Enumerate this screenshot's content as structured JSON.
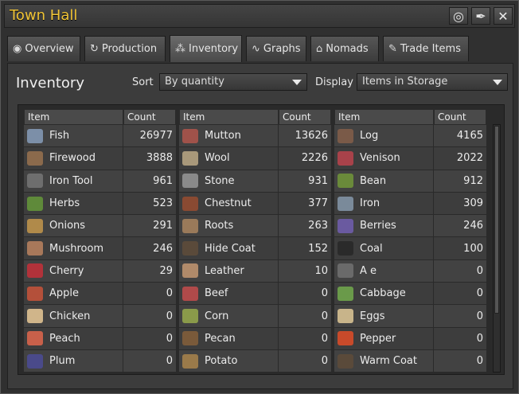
{
  "window": {
    "title": "Town Hall"
  },
  "window_buttons": [
    {
      "name": "target-icon",
      "glyph": "◎"
    },
    {
      "name": "pin-icon",
      "glyph": "✒"
    },
    {
      "name": "close-icon",
      "glyph": "✕"
    }
  ],
  "tabs": [
    {
      "label": "Overview",
      "icon": "eye-icon",
      "glyph": "◉",
      "active": false
    },
    {
      "label": "Production",
      "icon": "cycle-icon",
      "glyph": "↻",
      "active": false
    },
    {
      "label": "Inventory",
      "icon": "inventory-icon",
      "glyph": "⁂",
      "active": true
    },
    {
      "label": "Graphs",
      "icon": "graph-icon",
      "glyph": "∿",
      "active": false
    },
    {
      "label": "Nomads",
      "icon": "house-icon",
      "glyph": "⌂",
      "active": false
    },
    {
      "label": "Trade Items",
      "icon": "tag-icon",
      "glyph": "✎",
      "active": false
    }
  ],
  "inventory": {
    "title": "Inventory",
    "sort_label": "Sort",
    "sort_value": "By quantity",
    "display_label": "Display",
    "display_value": "Items in Storage"
  },
  "table": {
    "header_item": "Item",
    "header_count": "Count",
    "columns": [
      [
        {
          "name": "Fish",
          "count": "26977",
          "icon": "fish-icon",
          "color": "#7c8fa8"
        },
        {
          "name": "Firewood",
          "count": "3888",
          "icon": "firewood-icon",
          "color": "#8b6a4c"
        },
        {
          "name": "Iron Tool",
          "count": "961",
          "icon": "iron-tool-icon",
          "color": "#6e6e6e"
        },
        {
          "name": "Herbs",
          "count": "523",
          "icon": "herbs-icon",
          "color": "#5f8a3a"
        },
        {
          "name": "Onions",
          "count": "291",
          "icon": "onions-icon",
          "color": "#b08a4a"
        },
        {
          "name": "Mushroom",
          "count": "246",
          "icon": "mushroom-icon",
          "color": "#a8785a"
        },
        {
          "name": "Cherry",
          "count": "29",
          "icon": "cherry-icon",
          "color": "#b2323a"
        },
        {
          "name": "Apple",
          "count": "0",
          "icon": "apple-icon",
          "color": "#b4503a"
        },
        {
          "name": "Chicken",
          "count": "0",
          "icon": "chicken-icon",
          "color": "#d0b58a"
        },
        {
          "name": "Peach",
          "count": "0",
          "icon": "peach-icon",
          "color": "#c8604a"
        },
        {
          "name": "Plum",
          "count": "0",
          "icon": "plum-icon",
          "color": "#4a4a8a"
        }
      ],
      [
        {
          "name": "Mutton",
          "count": "13626",
          "icon": "mutton-icon",
          "color": "#a0524a"
        },
        {
          "name": "Wool",
          "count": "2226",
          "icon": "wool-icon",
          "color": "#a8987a"
        },
        {
          "name": "Stone",
          "count": "931",
          "icon": "stone-icon",
          "color": "#8a8a8a"
        },
        {
          "name": "Chestnut",
          "count": "377",
          "icon": "chestnut-icon",
          "color": "#8a4a32"
        },
        {
          "name": "Roots",
          "count": "263",
          "icon": "roots-icon",
          "color": "#9a7a5a"
        },
        {
          "name": "Hide Coat",
          "count": "152",
          "icon": "hide-coat-icon",
          "color": "#5a4a3a"
        },
        {
          "name": "Leather",
          "count": "10",
          "icon": "leather-icon",
          "color": "#b08a6a"
        },
        {
          "name": "Beef",
          "count": "0",
          "icon": "beef-icon",
          "color": "#b04a4a"
        },
        {
          "name": "Corn",
          "count": "0",
          "icon": "corn-icon",
          "color": "#8a9a4a"
        },
        {
          "name": "Pecan",
          "count": "0",
          "icon": "pecan-icon",
          "color": "#7a5a3a"
        },
        {
          "name": "Potato",
          "count": "0",
          "icon": "potato-icon",
          "color": "#9a7a4a"
        }
      ],
      [
        {
          "name": "Log",
          "count": "4165",
          "icon": "log-icon",
          "color": "#7a5a48"
        },
        {
          "name": "Venison",
          "count": "2022",
          "icon": "venison-icon",
          "color": "#a8424a"
        },
        {
          "name": "Bean",
          "count": "912",
          "icon": "bean-icon",
          "color": "#6a8a3a"
        },
        {
          "name": "Iron",
          "count": "309",
          "icon": "iron-icon",
          "color": "#7a8a9a"
        },
        {
          "name": "Berries",
          "count": "246",
          "icon": "berries-icon",
          "color": "#6a5aa0"
        },
        {
          "name": "Coal",
          "count": "100",
          "icon": "coal-icon",
          "color": "#2a2a2a"
        },
        {
          "name": "A e",
          "count": "0",
          "icon": "axe-icon",
          "color": "#6a6a6a"
        },
        {
          "name": "Cabbage",
          "count": "0",
          "icon": "cabbage-icon",
          "color": "#6a9a4a"
        },
        {
          "name": "Eggs",
          "count": "0",
          "icon": "eggs-icon",
          "color": "#c8b48a"
        },
        {
          "name": "Pepper",
          "count": "0",
          "icon": "pepper-icon",
          "color": "#c84a2a"
        },
        {
          "name": "Warm Coat",
          "count": "0",
          "icon": "warm-coat-icon",
          "color": "#5a4a3a"
        }
      ]
    ]
  },
  "scrollbar_fraction_visible": 0.76
}
